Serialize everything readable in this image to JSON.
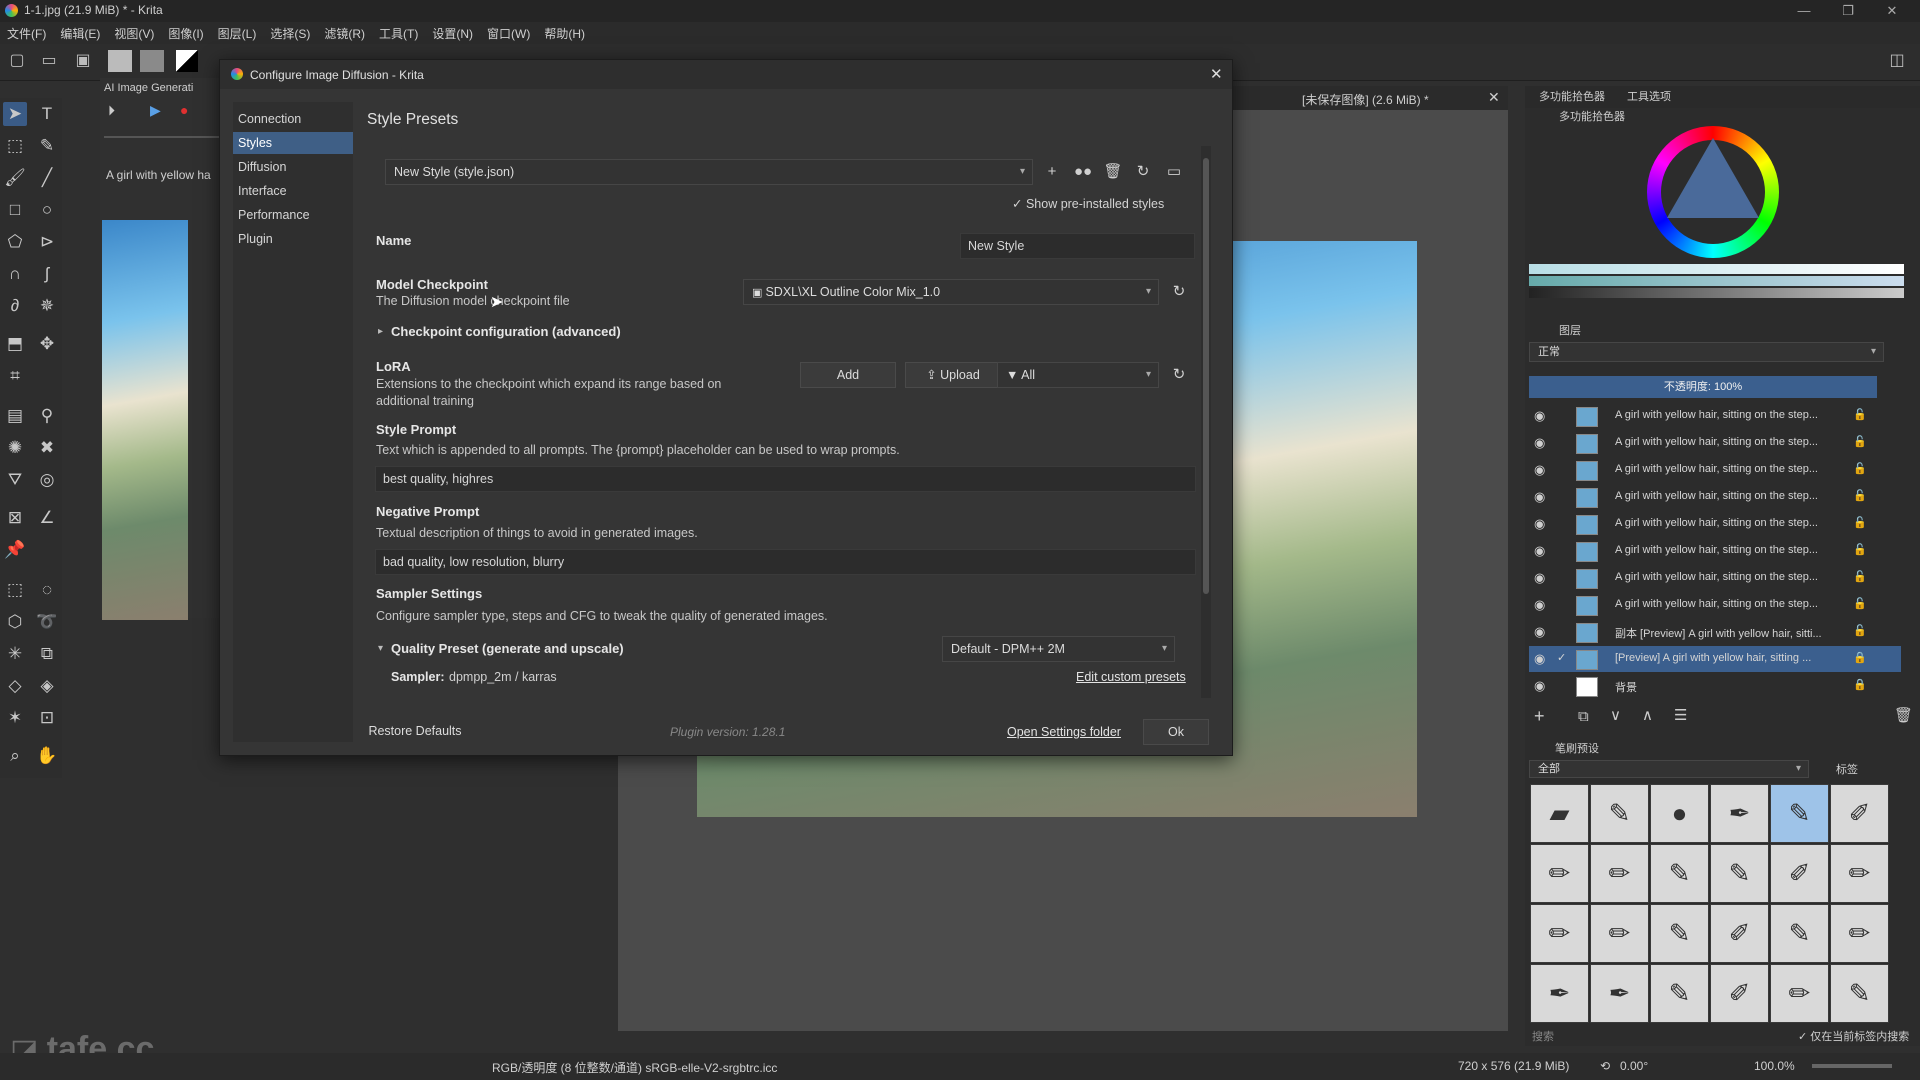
{
  "window": {
    "title": "1-1.jpg (21.9 MiB) * - Krita",
    "menu": [
      "文件(F)",
      "编辑(E)",
      "视图(V)",
      "图像(I)",
      "图层(L)",
      "选择(S)",
      "滤镜(R)",
      "工具(T)",
      "设置(N)",
      "窗口(W)",
      "帮助(H)"
    ]
  },
  "ai_panel": {
    "title": "AI Image Generati",
    "prompt_preview": "A girl with yellow ha"
  },
  "canvas_tab": {
    "label": "[未保存图像] (2.6 MiB) *"
  },
  "right_dock": {
    "tabs": [
      "多功能拾色器",
      "工具选项"
    ],
    "color_selector_title": "多功能拾色器",
    "layers_title": "图层",
    "blend_mode": "正常",
    "opacity": "不透明度: 100%",
    "layers": [
      {
        "name": "A girl with yellow hair, sitting on the step..."
      },
      {
        "name": "A girl with yellow hair, sitting on the step..."
      },
      {
        "name": "A girl with yellow hair, sitting on the step..."
      },
      {
        "name": "A girl with yellow hair, sitting on the step..."
      },
      {
        "name": "A girl with yellow hair, sitting on the step..."
      },
      {
        "name": "A girl with yellow hair, sitting on the step..."
      },
      {
        "name": "A girl with yellow hair, sitting on the step..."
      },
      {
        "name": "A girl with yellow hair, sitting on the step..."
      },
      {
        "name": "副本 [Preview] A girl with yellow hair, sitti..."
      },
      {
        "name": "[Preview] A girl with yellow hair, sitting ..."
      },
      {
        "name": "背景"
      }
    ],
    "brush_presets_title": "笔刷预设",
    "brush_filter": "全部",
    "brush_tag_label": "标签",
    "brush_search_placeholder": "搜索",
    "brush_search_in_tag": "仅在当前标签内搜索"
  },
  "status_bar": {
    "color_info": "RGB/透明度 (8 位整数/通道)  sRGB-elle-V2-srgbtrc.icc",
    "size": "720 x 576 (21.9 MiB)",
    "rotation": "0.00°",
    "zoom": "100.0%"
  },
  "dialog": {
    "title": "Configure Image Diffusion - Krita",
    "nav": [
      "Connection",
      "Styles",
      "Diffusion",
      "Interface",
      "Performance",
      "Plugin"
    ],
    "selected_nav": "Styles",
    "heading": "Style Presets",
    "preset_combo": "New Style (style.json)",
    "show_preinstalled": "Show pre-installed styles",
    "name_label": "Name",
    "name_value": "New Style",
    "checkpoint_label": "Model Checkpoint",
    "checkpoint_desc": "The Diffusion model checkpoint file",
    "checkpoint_value": "SDXL\\XL Outline Color Mix_1.0",
    "checkpoint_config": "Checkpoint configuration (advanced)",
    "lora_label": "LoRA",
    "lora_desc": "Extensions to the checkpoint which expand its range based on additional training",
    "lora_add": "Add",
    "lora_upload": "Upload",
    "lora_filter": "All",
    "style_prompt_label": "Style Prompt",
    "style_prompt_desc": "Text which is appended to all prompts. The {prompt} placeholder can be used to wrap prompts.",
    "style_prompt_value": "best quality, highres",
    "negative_prompt_label": "Negative Prompt",
    "negative_prompt_desc": "Textual description of things to avoid in generated images.",
    "negative_prompt_value": "bad quality, low resolution, blurry",
    "sampler_label": "Sampler Settings",
    "sampler_desc": "Configure sampler type, steps and CFG to tweak the quality of generated images.",
    "quality_preset_label": "Quality Preset (generate and upscale)",
    "quality_preset_value": "Default - DPM++ 2M",
    "sampler_key": "Sampler:",
    "sampler_value": "dpmpp_2m / karras",
    "edit_presets": "Edit custom presets",
    "restore_defaults": "Restore Defaults",
    "plugin_version": "Plugin version: 1.28.1",
    "open_settings_folder": "Open Settings folder",
    "ok": "Ok"
  },
  "watermark": "tafe.cc"
}
